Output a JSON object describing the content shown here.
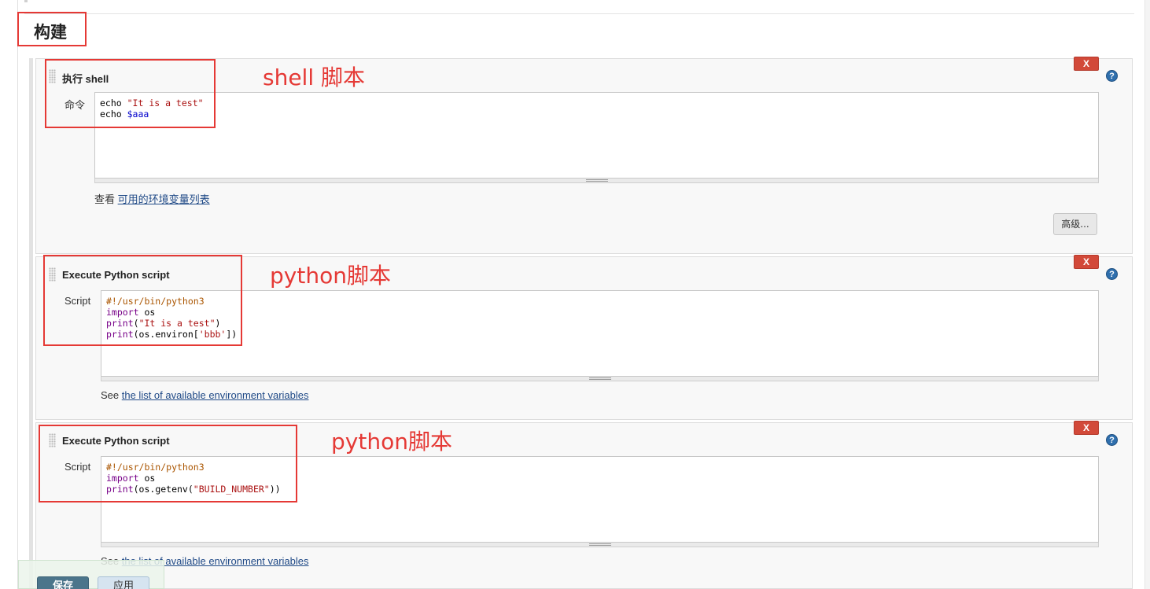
{
  "section": {
    "title": "构建"
  },
  "steps": [
    {
      "title": "执行 shell",
      "field_label": "命令",
      "code_lines": [
        [
          {
            "t": "echo ",
            "c": "plain"
          },
          {
            "t": "\"It is a test\"",
            "c": "str"
          }
        ],
        [
          {
            "t": "echo ",
            "c": "plain"
          },
          {
            "t": "$aaa",
            "c": "var"
          }
        ]
      ],
      "help_prefix": "查看 ",
      "help_link": "可用的环境变量列表",
      "advanced_label": "高级...",
      "delete_label": "X",
      "help_icon": "?",
      "annotation": "shell 脚本"
    },
    {
      "title": "Execute Python script",
      "field_label": "Script",
      "code_lines": [
        [
          {
            "t": "#!/usr/bin/python3",
            "c": "cmt"
          }
        ],
        [
          {
            "t": "import",
            "c": "kw"
          },
          {
            "t": " os",
            "c": "plain"
          }
        ],
        [
          {
            "t": "print",
            "c": "kw"
          },
          {
            "t": "(",
            "c": "plain"
          },
          {
            "t": "\"It is a test\"",
            "c": "str"
          },
          {
            "t": ")",
            "c": "plain"
          }
        ],
        [
          {
            "t": "print",
            "c": "kw"
          },
          {
            "t": "(os.environ[",
            "c": "plain"
          },
          {
            "t": "'bbb'",
            "c": "str"
          },
          {
            "t": "])",
            "c": "plain"
          }
        ]
      ],
      "help_prefix": "See ",
      "help_link": "the list of available environment variables",
      "delete_label": "X",
      "help_icon": "?",
      "annotation": "python脚本"
    },
    {
      "title": "Execute Python script",
      "field_label": "Script",
      "code_lines": [
        [
          {
            "t": "#!/usr/bin/python3",
            "c": "cmt"
          }
        ],
        [
          {
            "t": "import",
            "c": "kw"
          },
          {
            "t": " os",
            "c": "plain"
          }
        ],
        [
          {
            "t": "print",
            "c": "kw"
          },
          {
            "t": "(os.getenv(",
            "c": "plain"
          },
          {
            "t": "\"BUILD_NUMBER\"",
            "c": "str"
          },
          {
            "t": "))",
            "c": "plain"
          }
        ]
      ],
      "help_prefix": "See ",
      "help_link": "the list of available environment variables",
      "delete_label": "X",
      "help_icon": "?",
      "annotation": "python脚本"
    }
  ],
  "footer": {
    "save_label": "保存",
    "apply_label": "应用"
  },
  "colors": {
    "annotation": "#e53935",
    "delete": "#d24939",
    "help_icon": "#2f6fad",
    "save": "#4b758b"
  }
}
